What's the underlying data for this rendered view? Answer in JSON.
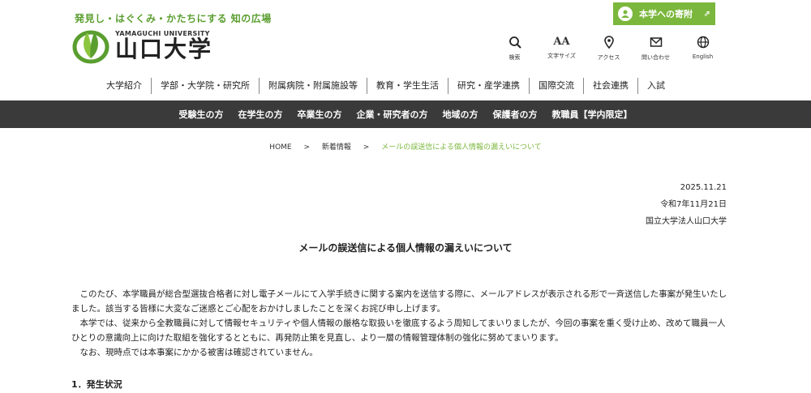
{
  "header": {
    "tagline": "発見し・はぐくみ・かたちにする 知の広場",
    "logo_en": "YAMAGUCHI UNIVERSITY",
    "logo_ja": "山口大学",
    "donate_label": "本学への寄附"
  },
  "tools": [
    {
      "label": "検索",
      "icon": "search-icon"
    },
    {
      "label": "文字サイズ",
      "icon": "font-size-icon"
    },
    {
      "label": "アクセス",
      "icon": "map-pin-icon"
    },
    {
      "label": "問い合わせ",
      "icon": "mail-icon"
    },
    {
      "label": "English",
      "icon": "globe-icon"
    }
  ],
  "font_glyph": "AA",
  "global_nav": [
    "大学紹介",
    "学部・大学院・研究所",
    "附属病院・附属施設等",
    "教育・学生生活",
    "研究・産学連携",
    "国際交流",
    "社会連携",
    "入試"
  ],
  "sub_nav": [
    "受験生の方",
    "在学生の方",
    "卒業生の方",
    "企業・研究者の方",
    "地域の方",
    "保護者の方",
    "教職員【学内限定】"
  ],
  "breadcrumb": {
    "home": "HOME",
    "sep": ">",
    "parent": "新着情報",
    "current": "メールの誤送信による個人情報の漏えいについて"
  },
  "meta": {
    "date": "2025.11.21",
    "date_ja": "令和7年11月21日",
    "org": "国立大学法人山口大学"
  },
  "article": {
    "title": "メールの誤送信による個人情報の漏えいについて",
    "paragraphs": [
      "このたび、本学職員が総合型選抜合格者に対し電子メールにて入学手続きに関する案内を送信する際に、メールアドレスが表示される形で一斉送信した事案が発生いたしました。該当する皆様に大変なご迷惑とご心配をおかけしましたことを深くお詫び申し上げます。",
      "本学では、従来から全教職員に対して情報セキュリティや個人情報の厳格な取扱いを徹底するよう周知してまいりましたが、今回の事案を重く受け止め、改めて職員一人ひとりの意識向上に向けた取組を強化するとともに、再発防止策を見直し、より一層の情報管理体制の強化に努めてまいります。",
      "なお、現時点では本事案にかかる被害は確認されていません。"
    ],
    "section1": "1．発生状況"
  },
  "colors": {
    "accent": "#7bb73c",
    "tagline": "#5a9e2f",
    "subnav_bg": "#3a3a3a"
  }
}
